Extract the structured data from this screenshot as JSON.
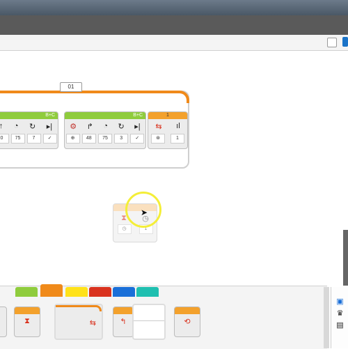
{
  "loop": {
    "label": "01",
    "count_value": "1"
  },
  "blocks": [
    {
      "port": "B+C",
      "values": [
        "0",
        "75",
        "7",
        "✓"
      ]
    },
    {
      "port": "B+C",
      "values": [
        "48",
        "75",
        "3",
        "✓"
      ]
    }
  ],
  "loop_condition_value": "1",
  "float_block_value": "1",
  "palette_tabs": [
    "green",
    "orange",
    "yellow",
    "red",
    "blue",
    "teal"
  ],
  "colors": {
    "green": "#8fcc3d",
    "orange": "#f08a1a",
    "yellow": "#ffe21a",
    "red": "#d9321e",
    "blue": "#1a6fd8",
    "teal": "#1fbfb0"
  }
}
